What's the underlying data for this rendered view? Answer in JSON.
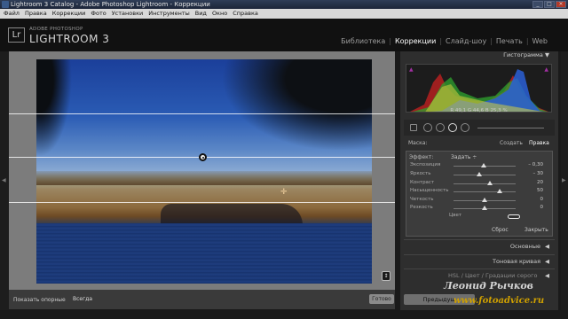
{
  "window": {
    "title": "Lightroom 3 Catalog - Adobe Photoshop Lightroom - Коррекции",
    "buttons": [
      "_",
      "□",
      "×"
    ]
  },
  "menubar": {
    "items": [
      "Файл",
      "Правка",
      "Коррекции",
      "Фото",
      "Установки",
      "Инструменты",
      "Вид",
      "Окно",
      "Справка"
    ]
  },
  "identity": {
    "logo": "Lr",
    "brand_small": "ADOBE PHOTOSHOP",
    "brand_big": "LIGHTROOM 3"
  },
  "modules": [
    {
      "label": "Библиотека",
      "active": false
    },
    {
      "label": "Коррекции",
      "active": true
    },
    {
      "label": "Слайд-шоу",
      "active": false
    },
    {
      "label": "Печать",
      "active": false
    },
    {
      "label": "Web",
      "active": false
    }
  ],
  "toolbar": {
    "show_pins_label": "Показать опорные",
    "show_pins_value": "Всегда",
    "done_label": "Готово"
  },
  "histogram": {
    "title": "Гистограмма",
    "r_label": "R",
    "r": "49,1",
    "g_label": "G",
    "g": "44,6",
    "b_label": "B",
    "b": "25,3",
    "unit": "%"
  },
  "mask": {
    "label": "Маска:",
    "create": "Создать",
    "edit": "Правка"
  },
  "adjustments": {
    "effect_label": "Эффект:",
    "effect_value": "Задать",
    "rows": [
      {
        "name": "Экспозиция",
        "value": "– 0,30",
        "pos": 0.49
      },
      {
        "name": "Яркость",
        "value": "– 30",
        "pos": 0.42
      },
      {
        "name": "Контраст",
        "value": "20",
        "pos": 0.58
      },
      {
        "name": "Насыщенность",
        "value": "50",
        "pos": 0.74
      },
      {
        "name": "Четкость",
        "value": "0",
        "pos": 0.5
      },
      {
        "name": "Резкость",
        "value": "0",
        "pos": 0.5
      },
      {
        "name": "Цвет",
        "value": "",
        "pos": null
      }
    ],
    "reset": "Сброс",
    "close": "Закрыть"
  },
  "sections": [
    {
      "label": "Основные"
    },
    {
      "label": "Тоновая кривая"
    },
    {
      "label": "HSL / Цвет / Градации серого"
    }
  ],
  "prev_button": "Предыдущ",
  "watermark": {
    "line1": "Леонид Рычков",
    "line2": "www.fotoadvice.ru"
  }
}
